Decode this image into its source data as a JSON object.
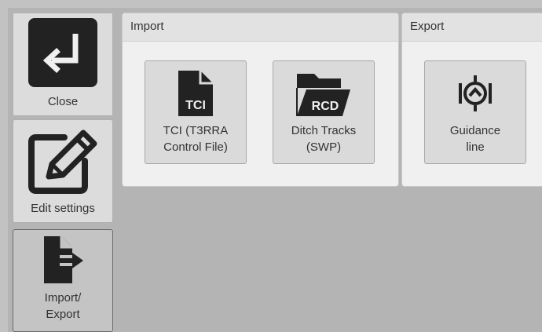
{
  "nav": {
    "close_label": "Close",
    "edit_settings_label": "Edit settings",
    "import_export_label_line1": "Import/",
    "import_export_label_line2": "Export",
    "close_icon": "return-arrow-icon",
    "edit_icon": "pencil-edit-icon",
    "import_export_icon": "file-export-icon"
  },
  "import": {
    "header": "Import",
    "tci": {
      "icon_text": "TCI",
      "label_line1": "TCI (T3RRA",
      "label_line2": "Control File)"
    },
    "ditch": {
      "icon_text": "RCD",
      "label_line1": "Ditch Tracks",
      "label_line2": "(SWP)"
    }
  },
  "export": {
    "header": "Export",
    "guidance": {
      "label_line1": "Guidance",
      "label_line2": "line"
    }
  },
  "colors": {
    "background": "#b4b4b4",
    "panel": "#f0f0f0",
    "tile": "#dadada",
    "icon_dark": "#222222"
  }
}
